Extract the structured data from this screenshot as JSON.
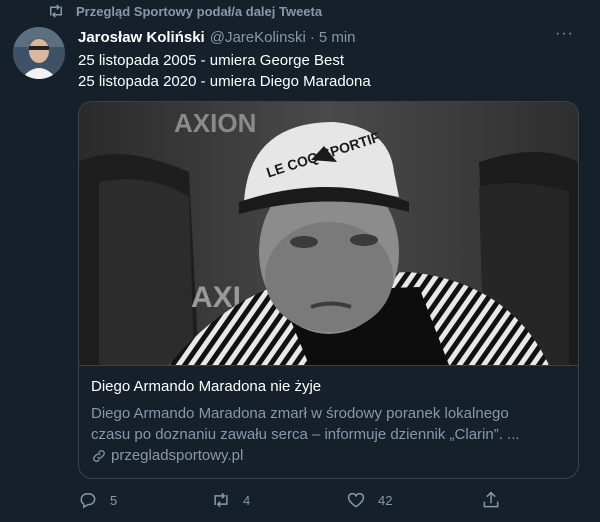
{
  "retweet": {
    "text": "Przegląd Sportowy podał/a dalej Tweeta",
    "icon": "retweet-icon"
  },
  "tweet": {
    "author_name": "Jarosław Koliński",
    "author_handle": "@JareKolinski",
    "separator": "·",
    "time": "5 min",
    "more": "···",
    "lines": [
      "25 listopada 2005 - umiera George Best",
      "25 listopada 2020 - umiera Diego Maradona"
    ]
  },
  "card": {
    "title": "Diego Armando Maradona nie żyje",
    "description_lines": [
      "Diego Armando Maradona zmarł w środowy poranek lokalnego",
      "czasu po doznaniu zawału serca – informuje dziennik „Clarin”. ..."
    ],
    "link": "przegladsportowy.pl",
    "image_texts": {
      "cap": "LE COQ SPORTIF",
      "banner_top": "AXION",
      "banner_left": "AXI"
    }
  },
  "actions": {
    "reply_count": "5",
    "retweet_count": "4",
    "like_count": "42"
  },
  "colors": {
    "background": "#15202b",
    "secondary_text": "#8899a6",
    "border": "#38444d",
    "primary_text": "#ffffff"
  }
}
